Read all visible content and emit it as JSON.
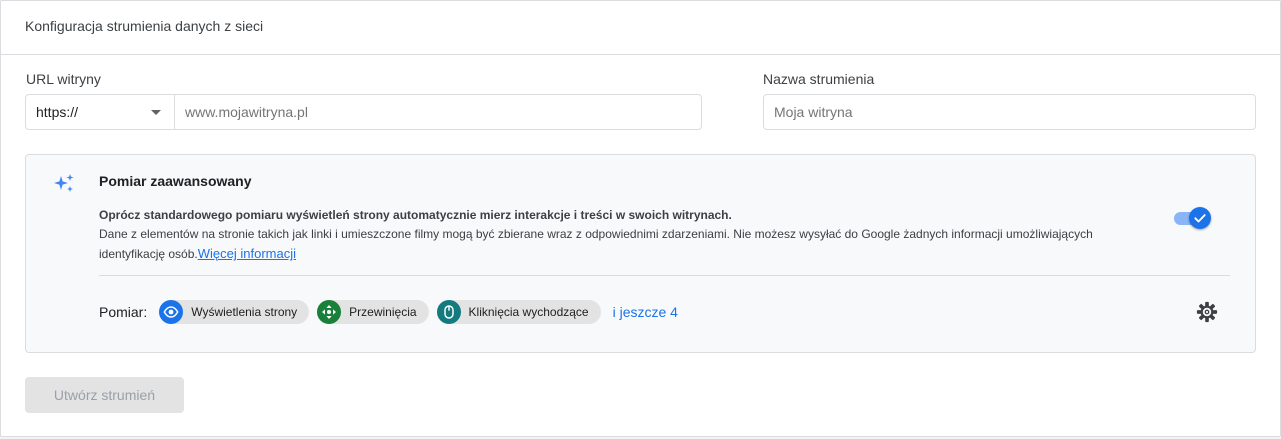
{
  "header": {
    "title": "Konfiguracja strumienia danych z sieci"
  },
  "url_field": {
    "label": "URL witryny",
    "protocol": "https://",
    "placeholder": "www.mojawitryna.pl"
  },
  "name_field": {
    "label": "Nazwa strumienia",
    "placeholder": "Moja witryna"
  },
  "enhanced": {
    "title": "Pomiar zaawansowany",
    "desc_bold": "Oprócz standardowego pomiaru wyświetleń strony automatycznie mierz interakcje i treści w swoich witrynach.",
    "desc": "Dane z elementów na stronie takich jak linki i umieszczone filmy mogą być zbierane wraz z odpowiednimi zdarzeniami. Nie możesz wysyłać do Google żadnych informacji umożliwiających identyfikację osób.",
    "link": "Więcej informacji",
    "toggle_on": true,
    "measure_label": "Pomiar:",
    "chips": [
      {
        "label": "Wyświetlenia strony",
        "icon": "eye-icon",
        "color": "#1a73e8"
      },
      {
        "label": "Przewinięcia",
        "icon": "scroll-arrows-icon",
        "color": "#188038"
      },
      {
        "label": "Kliknięcia wychodzące",
        "icon": "mouse-icon",
        "color": "#137a7f"
      }
    ],
    "more": "i jeszcze 4"
  },
  "create_button": {
    "label": "Utwórz strumień"
  },
  "colors": {
    "accent": "#1a73e8",
    "border": "#dadce0"
  }
}
